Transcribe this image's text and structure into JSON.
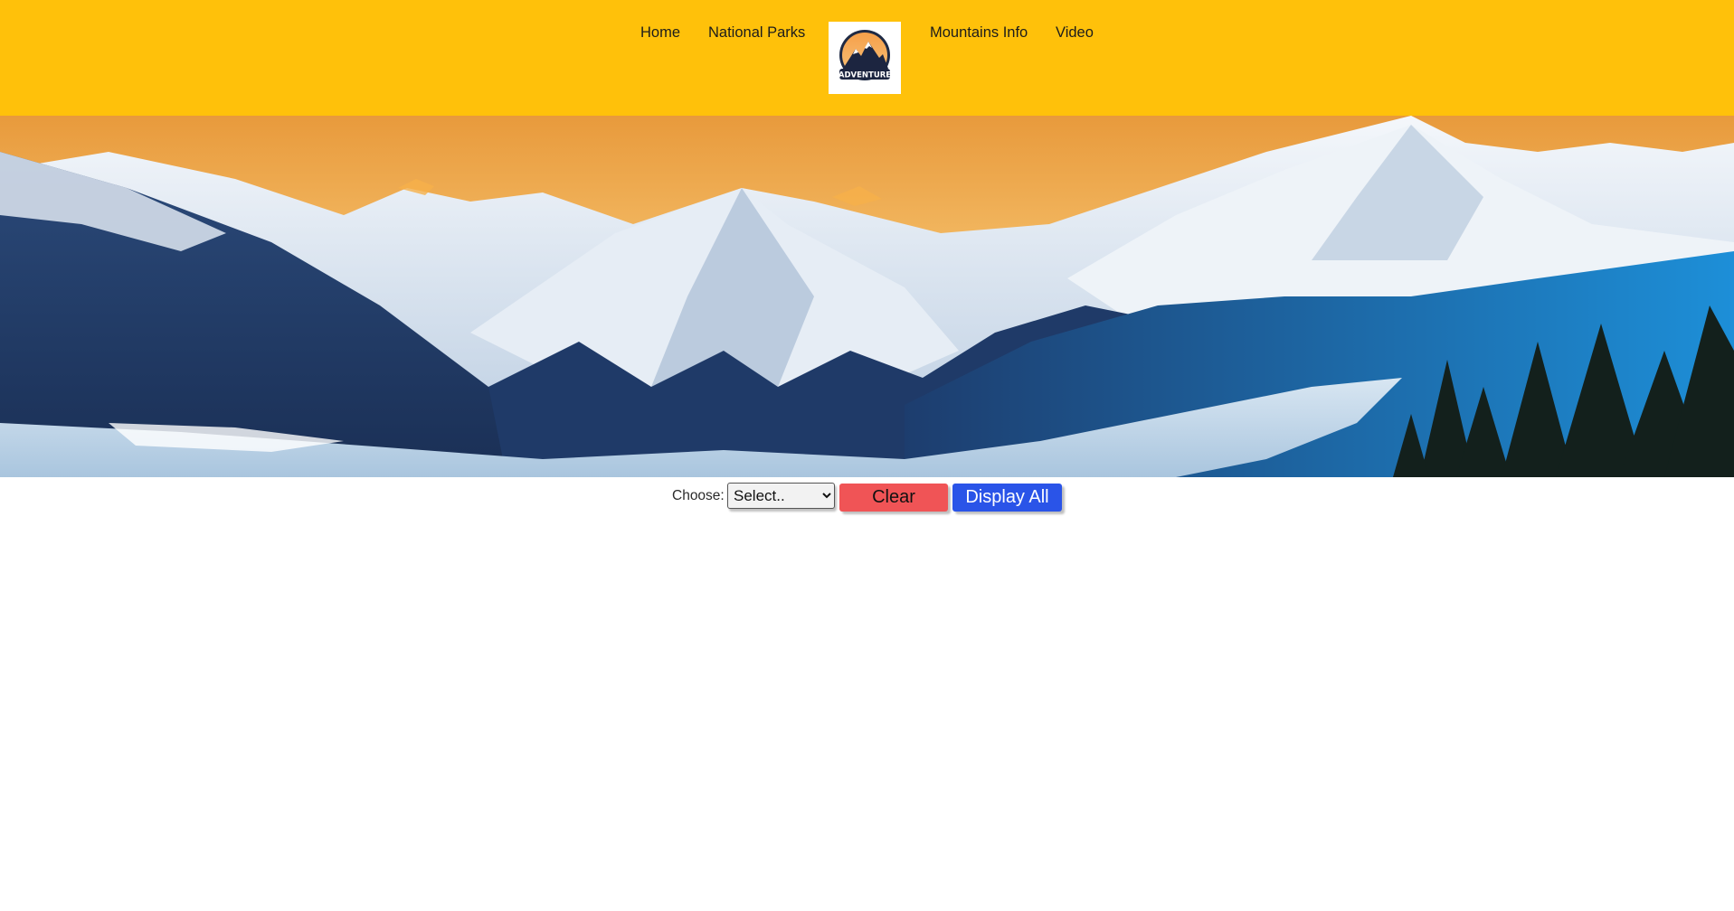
{
  "nav": {
    "left_links": [
      "Home",
      "National Parks"
    ],
    "right_links": [
      "Mountains Info",
      "Video"
    ],
    "logo_text": "ADVENTURE"
  },
  "colors": {
    "navbar_bg": "#ffc10a",
    "clear_button_bg": "#f05456",
    "display_all_button_bg": "#2a54e8"
  },
  "hero": {
    "image": "snowy-mountain-range-at-sunset"
  },
  "controls": {
    "choose_label": "Choose:",
    "select_value": "Select..",
    "clear_label": "Clear",
    "display_all_label": "Display All"
  }
}
